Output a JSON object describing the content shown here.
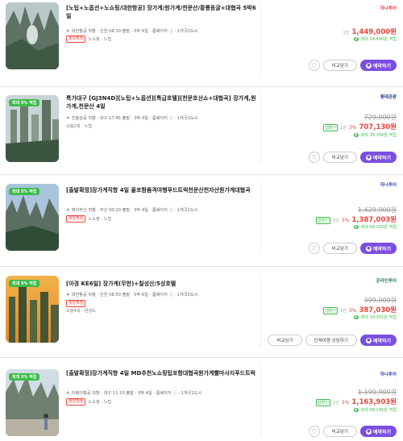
{
  "labels": {
    "compare": "비교담기",
    "book": "예약하기",
    "coupon": "앱할인",
    "app_price_prefix": "1인",
    "points_prefix": "최대",
    "points_suffix": "적립",
    "heart_icon": "♡"
  },
  "colors": {
    "price": "#e8453c",
    "accent": "#7b4ee0",
    "points": "#3dbb4a"
  },
  "products": [
    {
      "title": "[노팁+노옵션+노쇼핑/대한항공] 장가계/원가계/천문산/황룡동굴+대협곡 5박6일",
      "agency": "대한항공 직항 · 인천 08:30 출발 · 5박 6일 · 룸쉐어지 ⓘ · 1개국2도시",
      "tag": "출발확정",
      "tags_text": "노쇼핑 · 노팁",
      "badge": "",
      "brand": "하나투어",
      "brand_color": "#e8453c",
      "orig_price": "",
      "pct": "",
      "has_coupon": false,
      "price": "1,449,000원",
      "points": "14,490원"
    },
    {
      "title": "특가대구 [GJ3N4D][노팁+노옵션][특급호텔][천문호선쇼+대협곡] 장가계,원가계,천문산 4일",
      "agency": "진흥삼공 직항 · 대구 17:45 출발 · 3박 4일 · 룸쉐어지 ⓘ · 1개국1도시",
      "tag": "",
      "tags_text": "쇼핑2회 · 노팁",
      "badge": "최대 5% 적립",
      "brand": "롯데관광",
      "brand_color": "#1b3d8f",
      "orig_price": "729,000원",
      "pct": "3%",
      "has_coupon": true,
      "price": "707,130원",
      "points": "35,356원"
    },
    {
      "title": "[출발확정]장가계직항 4일 올포함품격여행푸드트럭천문산천자산원가계대협곡",
      "agency": "에어부산 직항 · 부산 00:20 출발 · 3박 4일 · 룸쉐어지 ⓘ · 1개국1도시",
      "tag": "출발확정",
      "tags_text": "노쇼핑 · 노팁",
      "badge": "최대 5% 적립",
      "brand": "하나투어",
      "brand_color": "#3a4fb8",
      "orig_price": "1,429,900원",
      "pct": "3%",
      "has_coupon": true,
      "price": "1,387,003원",
      "points": "69,350원"
    },
    {
      "title": "[아경 KE6일] 장가계(무한)+칠성산/5성호텔",
      "agency": "대한항공 직항 · 인천 08:50 출발 · 5박 6일 · 룸쉐어지 ⓘ · 1개국2도시",
      "tag": "출발확정",
      "tags_text": "쇼핑4회 · 현생도",
      "badge": "최대 5% 적립",
      "brand": "온라인투어",
      "brand_color": "#2a7f4a",
      "orig_price": "399,000원",
      "pct": "3%",
      "has_coupon": true,
      "price": "387,030원",
      "points": "19,351원",
      "extra_button": "단체여행 상담하기"
    },
    {
      "title": "[출발확정]장가계직항 4일 MD추천노쇼핑팁포함대협곡원가계빨마사지푸드트럭",
      "agency": "티웨이항공 직항 · 대구 11:10 출발 · 3박 4일 · 룸쉐어지 ⓘ · 1개국1도시",
      "tag": "출발확정",
      "tags_text": "노쇼핑 · 노팁",
      "badge": "최대 5% 적립",
      "brand": "하나투어",
      "brand_color": "#3a4fb8",
      "orig_price": "1,199,900원",
      "pct": "3%",
      "has_coupon": true,
      "price": "1,163,903원",
      "points": "58,195원"
    }
  ]
}
